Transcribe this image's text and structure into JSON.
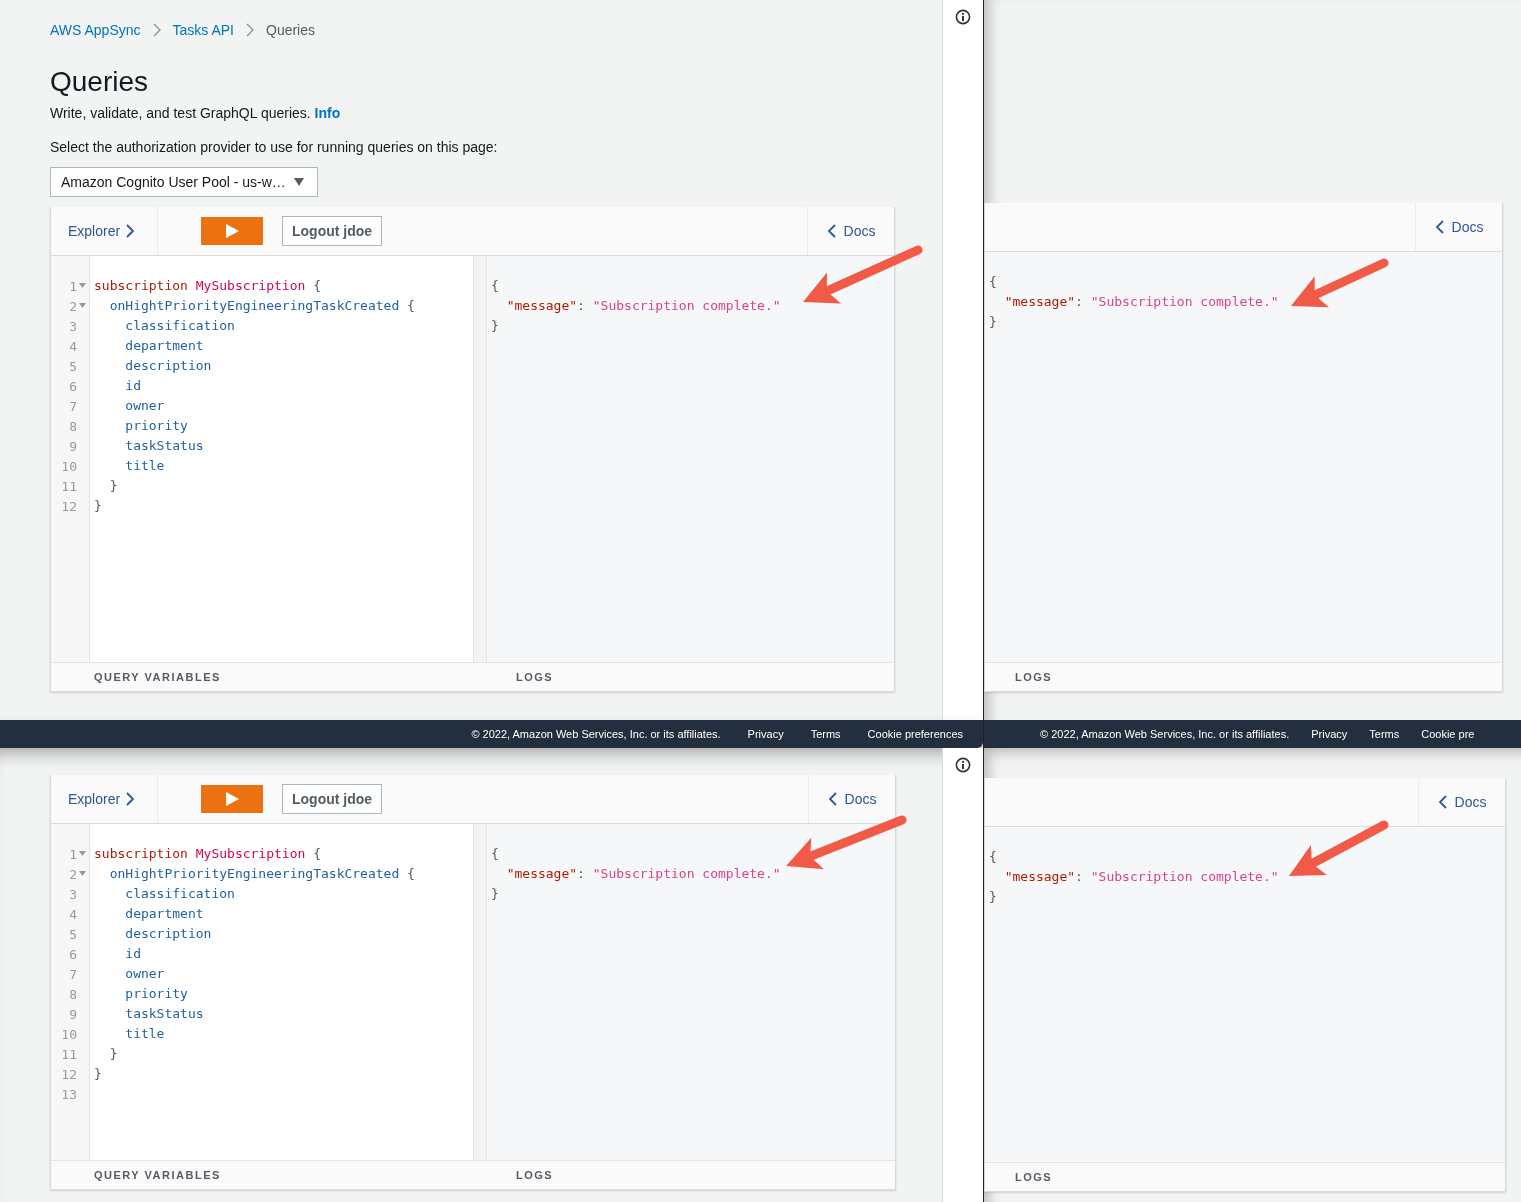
{
  "windows": [
    {
      "kind": "console",
      "breadcrumbs": [
        {
          "label": "AWS AppSync",
          "link": true
        },
        {
          "label": "Tasks API",
          "link": true
        },
        {
          "label": "Queries",
          "link": false
        }
      ],
      "title": "Queries",
      "description": "Write, validate, and test GraphQL queries.",
      "info_link": "Info",
      "auth_label": "Select the authorization provider to use for running queries on this page:",
      "auth_provider": "Amazon Cognito User Pool - us-w…",
      "editor": {
        "explorer": "Explorer",
        "logout": "Logout jdoe",
        "docs": "Docs",
        "query_lines": [
          {
            "number": "1",
            "foldable": true,
            "tokens": [
              {
                "kind": "keyword",
                "text": "subscription"
              },
              {
                "kind": "def",
                "text": " MySubscription"
              },
              {
                "kind": "punct",
                "text": " {"
              }
            ]
          },
          {
            "number": "2",
            "foldable": true,
            "tokens": [
              {
                "kind": "field",
                "text": "  onHightPriorityEngineeringTaskCreated"
              },
              {
                "kind": "punct",
                "text": " {"
              }
            ]
          },
          {
            "number": "3",
            "foldable": false,
            "tokens": [
              {
                "kind": "field",
                "text": "    classification"
              }
            ]
          },
          {
            "number": "4",
            "foldable": false,
            "tokens": [
              {
                "kind": "field",
                "text": "    department"
              }
            ]
          },
          {
            "number": "5",
            "foldable": false,
            "tokens": [
              {
                "kind": "field",
                "text": "    description"
              }
            ]
          },
          {
            "number": "6",
            "foldable": false,
            "tokens": [
              {
                "kind": "field",
                "text": "    id"
              }
            ]
          },
          {
            "number": "7",
            "foldable": false,
            "tokens": [
              {
                "kind": "field",
                "text": "    owner"
              }
            ]
          },
          {
            "number": "8",
            "foldable": false,
            "tokens": [
              {
                "kind": "field",
                "text": "    priority"
              }
            ]
          },
          {
            "number": "9",
            "foldable": false,
            "tokens": [
              {
                "kind": "field",
                "text": "    taskStatus"
              }
            ]
          },
          {
            "number": "10",
            "foldable": false,
            "tokens": [
              {
                "kind": "field",
                "text": "    title"
              }
            ]
          },
          {
            "number": "11",
            "foldable": false,
            "tokens": [
              {
                "kind": "punct",
                "text": "  }"
              }
            ]
          },
          {
            "number": "12",
            "foldable": false,
            "tokens": [
              {
                "kind": "punct",
                "text": "}"
              }
            ]
          }
        ],
        "result_lines": [
          {
            "tokens": [
              {
                "kind": "punct",
                "text": "{"
              }
            ]
          },
          {
            "tokens": [
              {
                "kind": "key",
                "text": "  \"message\""
              },
              {
                "kind": "punct",
                "text": ": "
              },
              {
                "kind": "string",
                "text": "\"Subscription complete.\""
              }
            ]
          },
          {
            "tokens": [
              {
                "kind": "punct",
                "text": "}"
              }
            ]
          }
        ],
        "query_variables": "QUERY VARIABLES",
        "logs": "LOGS"
      },
      "footer": {
        "copyright": "© 2022, Amazon Web Services, Inc. or its affiliates.",
        "links": [
          "Privacy",
          "Terms",
          "Cookie preferences"
        ]
      }
    },
    {
      "kind": "result",
      "editor": {
        "docs": "Docs",
        "result_lines": [
          {
            "tokens": [
              {
                "kind": "punct",
                "text": "{"
              }
            ]
          },
          {
            "tokens": [
              {
                "kind": "key",
                "text": "  \"message\""
              },
              {
                "kind": "punct",
                "text": ": "
              },
              {
                "kind": "string",
                "text": "\"Subscription complete.\""
              }
            ]
          },
          {
            "tokens": [
              {
                "kind": "punct",
                "text": "}"
              }
            ]
          }
        ],
        "logs": "LOGS"
      },
      "footer": {
        "copyright": "© 2022, Amazon Web Services, Inc. or its affiliates.",
        "links": [
          "Privacy",
          "Terms",
          "Cookie pre"
        ]
      }
    },
    {
      "kind": "console",
      "editor": {
        "explorer": "Explorer",
        "logout": "Logout jdoe",
        "docs": "Docs",
        "query_lines": [
          {
            "number": "1",
            "foldable": true,
            "tokens": [
              {
                "kind": "keyword",
                "text": "subscription"
              },
              {
                "kind": "def",
                "text": " MySubscription"
              },
              {
                "kind": "punct",
                "text": " {"
              }
            ]
          },
          {
            "number": "2",
            "foldable": true,
            "tokens": [
              {
                "kind": "field",
                "text": "  onHightPriorityEngineeringTaskCreated"
              },
              {
                "kind": "punct",
                "text": " {"
              }
            ]
          },
          {
            "number": "3",
            "foldable": false,
            "tokens": [
              {
                "kind": "field",
                "text": "    classification"
              }
            ]
          },
          {
            "number": "4",
            "foldable": false,
            "tokens": [
              {
                "kind": "field",
                "text": "    department"
              }
            ]
          },
          {
            "number": "5",
            "foldable": false,
            "tokens": [
              {
                "kind": "field",
                "text": "    description"
              }
            ]
          },
          {
            "number": "6",
            "foldable": false,
            "tokens": [
              {
                "kind": "field",
                "text": "    id"
              }
            ]
          },
          {
            "number": "7",
            "foldable": false,
            "tokens": [
              {
                "kind": "field",
                "text": "    owner"
              }
            ]
          },
          {
            "number": "8",
            "foldable": false,
            "tokens": [
              {
                "kind": "field",
                "text": "    priority"
              }
            ]
          },
          {
            "number": "9",
            "foldable": false,
            "tokens": [
              {
                "kind": "field",
                "text": "    taskStatus"
              }
            ]
          },
          {
            "number": "10",
            "foldable": false,
            "tokens": [
              {
                "kind": "field",
                "text": "    title"
              }
            ]
          },
          {
            "number": "11",
            "foldable": false,
            "tokens": [
              {
                "kind": "punct",
                "text": "  }"
              }
            ]
          },
          {
            "number": "12",
            "foldable": false,
            "tokens": [
              {
                "kind": "punct",
                "text": "}"
              }
            ]
          },
          {
            "number": "13",
            "foldable": false
          }
        ],
        "result_lines": [
          {
            "tokens": [
              {
                "kind": "punct",
                "text": "{"
              }
            ]
          },
          {
            "tokens": [
              {
                "kind": "key",
                "text": "  \"message\""
              },
              {
                "kind": "punct",
                "text": ": "
              },
              {
                "kind": "string",
                "text": "\"Subscription complete.\""
              }
            ]
          },
          {
            "tokens": [
              {
                "kind": "punct",
                "text": "}"
              }
            ]
          }
        ],
        "query_variables": "QUERY VARIABLES",
        "logs": "LOGS"
      }
    },
    {
      "kind": "result",
      "editor": {
        "docs": "Docs",
        "result_lines": [
          {
            "tokens": [
              {
                "kind": "punct",
                "text": "{"
              }
            ]
          },
          {
            "tokens": [
              {
                "kind": "key",
                "text": "  \"message\""
              },
              {
                "kind": "punct",
                "text": ": "
              },
              {
                "kind": "string",
                "text": "\"Subscription complete.\""
              }
            ]
          },
          {
            "tokens": [
              {
                "kind": "punct",
                "text": "}"
              }
            ]
          }
        ],
        "logs": "LOGS"
      }
    }
  ]
}
